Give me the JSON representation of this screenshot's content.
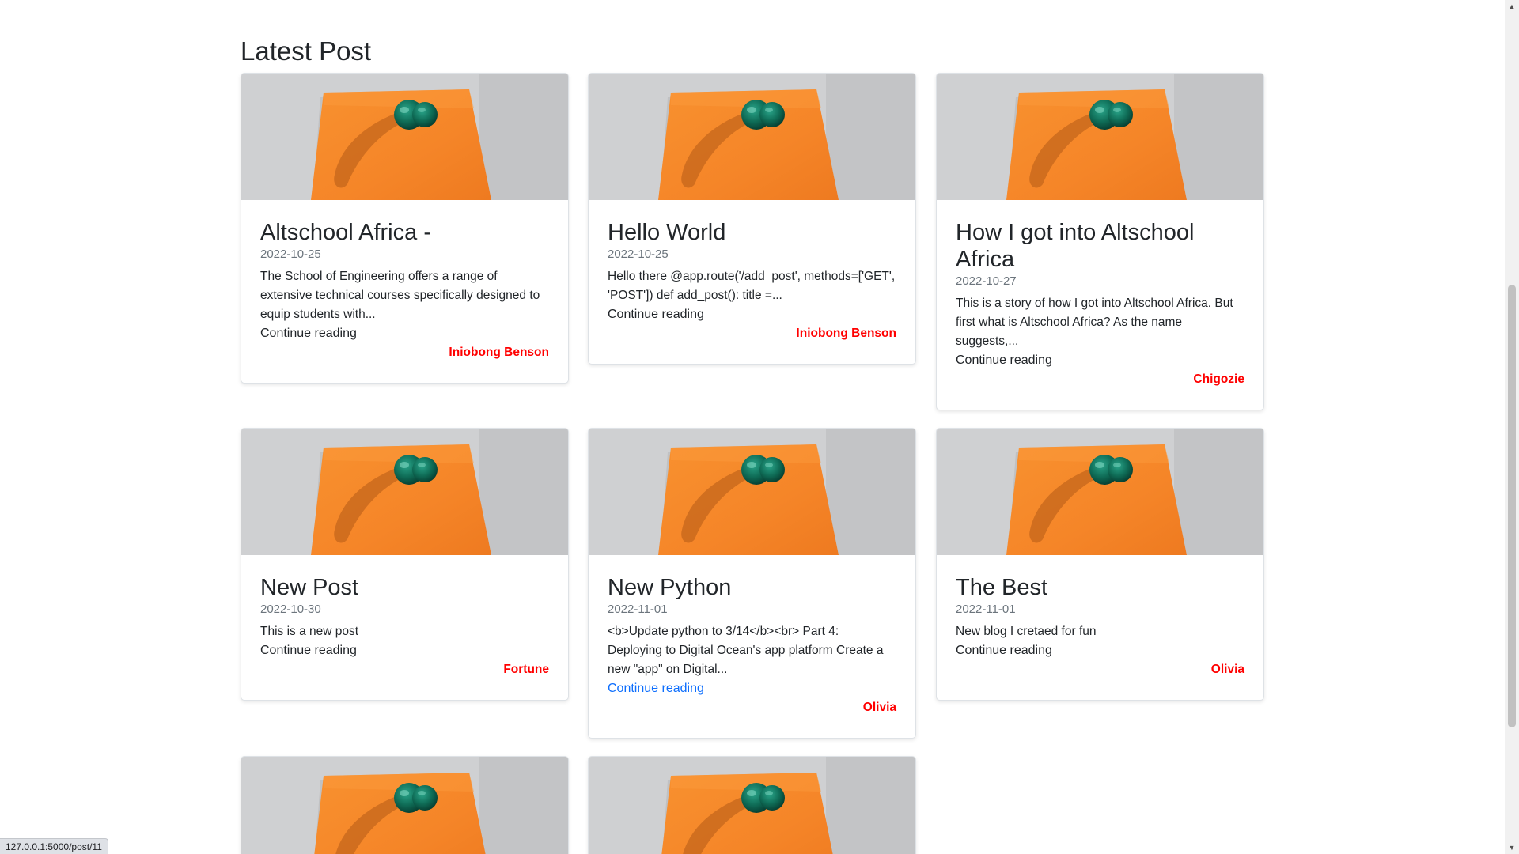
{
  "section": {
    "title": "Latest Post"
  },
  "posts": [
    {
      "title": "Altschool Africa -",
      "date": "2022-10-25",
      "excerpt": "The School of Engineering offers a range of extensive technical courses specifically designed to equip students with...",
      "link_label": "Continue reading",
      "author": "Iniobong Benson"
    },
    {
      "title": "Hello World",
      "date": "2022-10-25",
      "excerpt": "Hello there @app.route('/add_post', methods=['GET', 'POST']) def add_post(): title =...",
      "link_label": "Continue reading",
      "author": "Iniobong Benson"
    },
    {
      "title": "How I got into Altschool Africa",
      "date": "2022-10-27",
      "excerpt": "This is a story of how I got into Altschool Africa. But first what is Altschool Africa? As the name suggests,...",
      "link_label": "Continue reading",
      "author": "Chigozie"
    },
    {
      "title": "New Post",
      "date": "2022-10-30",
      "excerpt": "This is a new post",
      "link_label": "Continue reading",
      "author": "Fortune"
    },
    {
      "title": "New Python",
      "date": "2022-11-01",
      "excerpt": "<b>Update python to 3/14</b><br> Part 4: Deploying to Digital Ocean's app platform Create a new \"app\" on Digital...",
      "link_label": "Continue reading",
      "author": "Olivia"
    },
    {
      "title": "The Best",
      "date": "2022-11-01",
      "excerpt": "New blog I cretaed for fun",
      "link_label": "Continue reading",
      "author": "Olivia"
    }
  ],
  "status_bar": {
    "url": "127.0.0.1:5000/post/11"
  },
  "colors": {
    "author": "#ff0000",
    "link_hover": "#0d6efd",
    "date": "#6c757d",
    "sticky_note": "#f7892d",
    "pushpin": "#0e6b55"
  },
  "icons": {
    "post_image": "sticky-note-pushpin-image",
    "scroll_up": "scroll-up-arrow-icon",
    "scroll_down": "scroll-down-arrow-icon"
  }
}
